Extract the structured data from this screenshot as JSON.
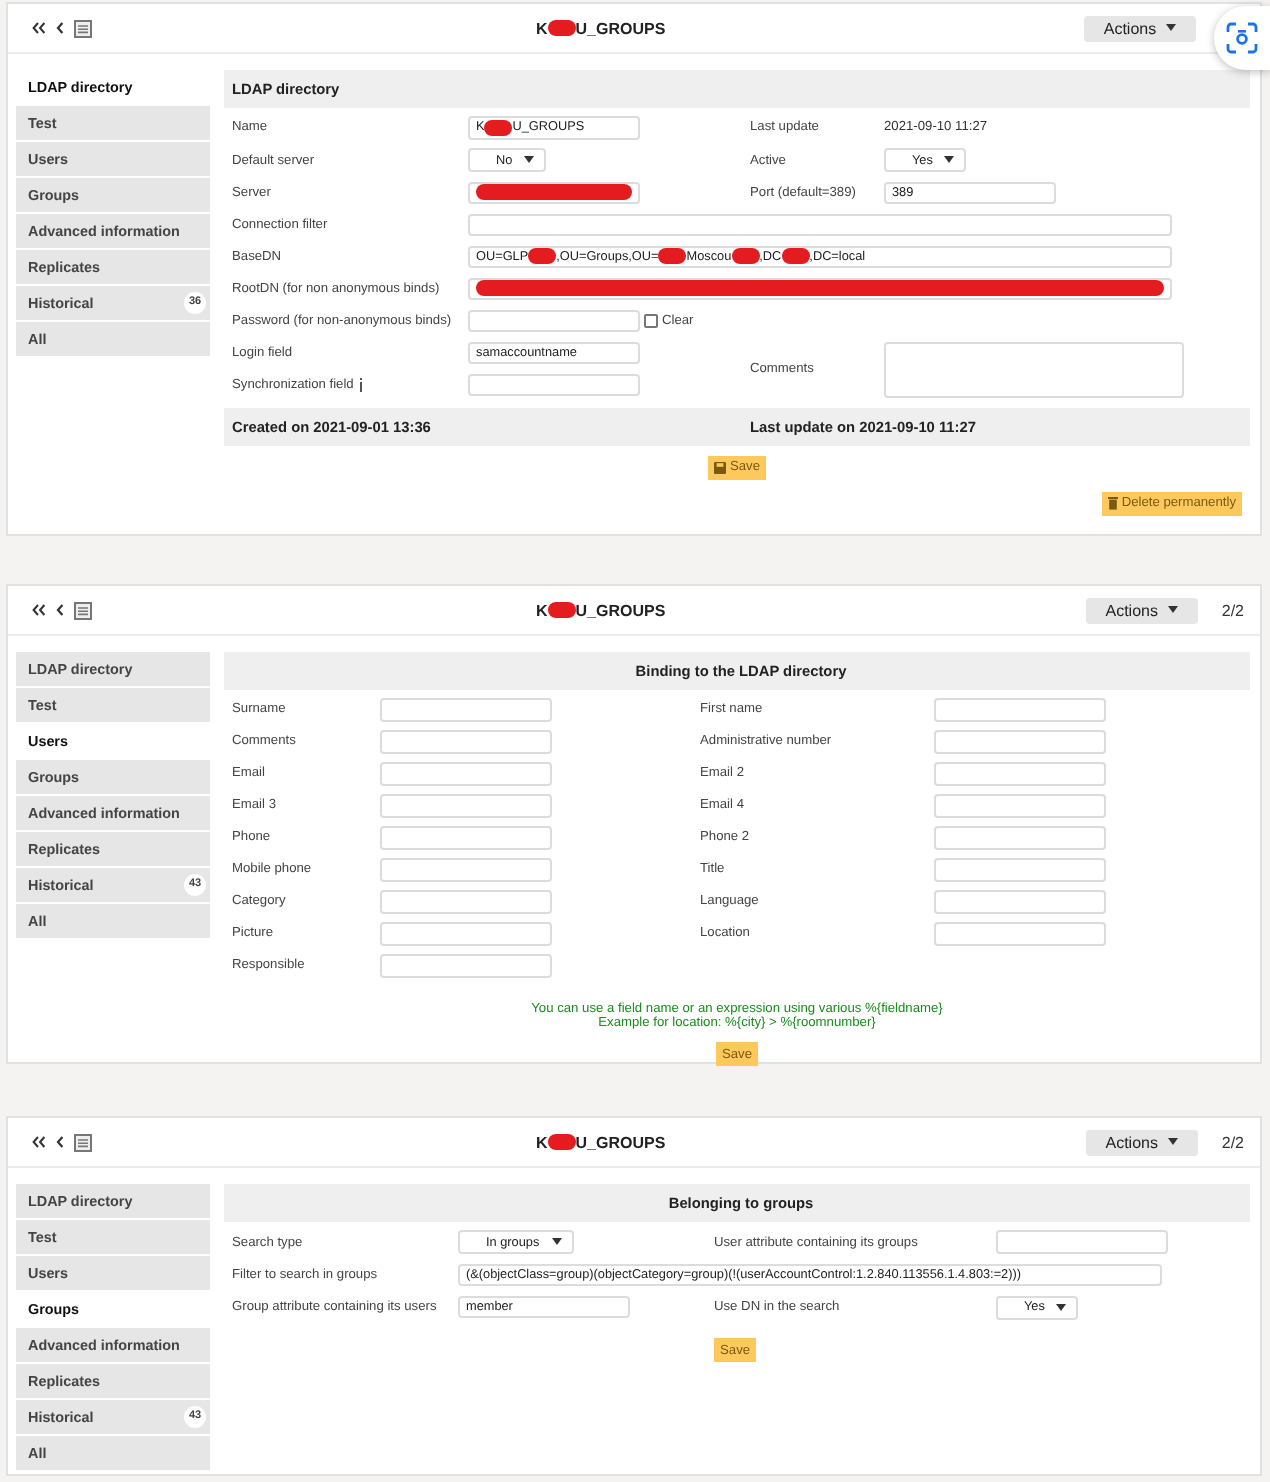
{
  "panels": [
    {
      "kind": "ldap",
      "title_parts": [
        "K",
        "U_GROUPS"
      ],
      "actions": "Actions",
      "sidebar": [
        {
          "label": "LDAP directory",
          "selected": true
        },
        {
          "label": "Test",
          "selected": false
        },
        {
          "label": "Users",
          "selected": false
        },
        {
          "label": "Groups",
          "selected": false
        },
        {
          "label": "Advanced information",
          "selected": false
        },
        {
          "label": "Replicates",
          "selected": false
        },
        {
          "label": "Historical",
          "selected": false,
          "badge": "36"
        },
        {
          "label": "All",
          "selected": false
        }
      ],
      "section_title": "LDAP directory",
      "cells": [
        {
          "label": "Name",
          "field": {
            "kind": "input",
            "parts": [
              "K",
              "U_GROUPS"
            ]
          }
        },
        {
          "label": "Last update",
          "field": {
            "kind": "text",
            "value": "2021-09-10 11:27"
          }
        },
        {
          "label": "Default server",
          "field": {
            "kind": "select",
            "value": "No"
          }
        },
        {
          "label": "Active",
          "field": {
            "kind": "select",
            "value": "Yes"
          }
        },
        {
          "label": "Server",
          "field": {
            "kind": "redacted"
          }
        },
        {
          "label": "Port (default=389)",
          "field": {
            "kind": "input",
            "parts": [
              "389"
            ]
          }
        },
        {
          "label": "Connection filter",
          "field": {
            "kind": "wide"
          }
        },
        {
          "label": "BaseDN",
          "field": {
            "kind": "wide",
            "parts": [
              "OU=GLP",
              ",OU=Groups,OU=",
              "Moscou",
              ",DC",
              ",DC=local"
            ]
          }
        },
        {
          "label": "RootDN (for non anonymous binds)",
          "field": {
            "kind": "redacted_wide"
          }
        },
        {
          "label": "Password (for non-anonymous binds)",
          "field": {
            "kind": "password",
            "clear": {
              "label": "Clear",
              "checked": false
            }
          }
        },
        {
          "label": "Login field",
          "field": {
            "kind": "input",
            "parts": [
              "samaccountname"
            ]
          }
        },
        {
          "label": "Comments",
          "field": {
            "kind": "textarea"
          }
        },
        {
          "label": "Synchronization field",
          "info": true,
          "field": {
            "kind": "input"
          }
        }
      ],
      "dates": [
        "Created on 2021-09-01 13:36",
        "Last update on 2021-09-10 11:27"
      ],
      "buttons": [
        {
          "label": "Save",
          "kind": "save"
        },
        {
          "label": "Delete permanently",
          "kind": "delete"
        }
      ]
    },
    {
      "kind": "users",
      "title_parts": [
        "K",
        "U_GROUPS"
      ],
      "actions": "Actions",
      "pager": "2/2",
      "sidebar": [
        {
          "label": "LDAP directory",
          "selected": false
        },
        {
          "label": "Test",
          "selected": false
        },
        {
          "label": "Users",
          "selected": true
        },
        {
          "label": "Groups",
          "selected": false
        },
        {
          "label": "Advanced information",
          "selected": false
        },
        {
          "label": "Replicates",
          "selected": false
        },
        {
          "label": "Historical",
          "selected": false,
          "badge": "43"
        },
        {
          "label": "All",
          "selected": false
        }
      ],
      "section_title": "Binding to the LDAP directory",
      "cells": [
        {
          "label": "Surname",
          "field": {
            "kind": "input"
          }
        },
        {
          "label": "First name",
          "field": {
            "kind": "input"
          }
        },
        {
          "label": "Comments",
          "field": {
            "kind": "input"
          }
        },
        {
          "label": "Administrative number",
          "field": {
            "kind": "input"
          }
        },
        {
          "label": "Email",
          "field": {
            "kind": "input"
          }
        },
        {
          "label": "Email 2",
          "field": {
            "kind": "input"
          }
        },
        {
          "label": "Email 3",
          "field": {
            "kind": "input"
          }
        },
        {
          "label": "Email 4",
          "field": {
            "kind": "input"
          }
        },
        {
          "label": "Phone",
          "field": {
            "kind": "input"
          }
        },
        {
          "label": "Phone 2",
          "field": {
            "kind": "input"
          }
        },
        {
          "label": "Mobile phone",
          "field": {
            "kind": "input"
          }
        },
        {
          "label": "Title",
          "field": {
            "kind": "input"
          }
        },
        {
          "label": "Category",
          "field": {
            "kind": "input"
          }
        },
        {
          "label": "Language",
          "field": {
            "kind": "input"
          }
        },
        {
          "label": "Picture",
          "field": {
            "kind": "input"
          }
        },
        {
          "label": "Location",
          "field": {
            "kind": "input"
          }
        },
        {
          "label": "Responsible",
          "field": {
            "kind": "input"
          }
        }
      ],
      "hint": [
        "You can use a field name or an expression using various %{fieldname}",
        "Example for location: %{city} > %{roomnumber}"
      ],
      "buttons": [
        {
          "label": "Save",
          "kind": "submit"
        }
      ]
    },
    {
      "kind": "groups",
      "title_parts": [
        "K",
        "U_GROUPS"
      ],
      "actions": "Actions",
      "pager": "2/2",
      "sidebar": [
        {
          "label": "LDAP directory",
          "selected": false
        },
        {
          "label": "Test",
          "selected": false
        },
        {
          "label": "Users",
          "selected": false
        },
        {
          "label": "Groups",
          "selected": true
        },
        {
          "label": "Advanced information",
          "selected": false
        },
        {
          "label": "Replicates",
          "selected": false
        },
        {
          "label": "Historical",
          "selected": false,
          "badge": "43"
        },
        {
          "label": "All",
          "selected": false
        }
      ],
      "section_title": "Belonging to groups",
      "cells": [
        {
          "label": "Search type",
          "field": {
            "kind": "select",
            "value": "In groups"
          }
        },
        {
          "label": "User attribute containing its groups",
          "field": {
            "kind": "input"
          }
        },
        {
          "label": "Filter to search in groups",
          "field": {
            "kind": "wide",
            "parts": [
              "(&(objectClass=group)(objectCategory=group)(!(userAccountControl:1.2.840.113556.1.4.803:=2)))"
            ]
          }
        },
        {
          "label": "Group attribute containing its users",
          "field": {
            "kind": "input",
            "parts": [
              "member"
            ]
          }
        },
        {
          "label": "Use DN in the search",
          "field": {
            "kind": "select",
            "value": "Yes"
          }
        }
      ],
      "buttons": [
        {
          "label": "Save",
          "kind": "submit"
        }
      ]
    }
  ]
}
